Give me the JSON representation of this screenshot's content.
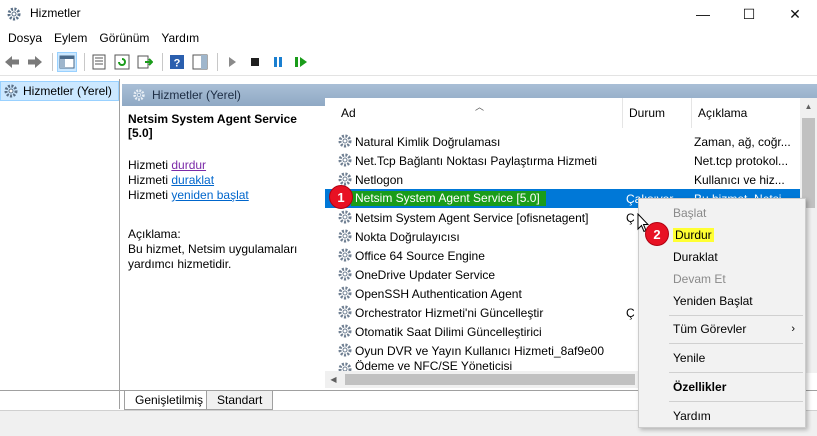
{
  "window": {
    "title": "Hizmetler",
    "min_glyph": "—",
    "max_glyph": "☐",
    "close_glyph": "✕"
  },
  "menu": [
    "Dosya",
    "Eylem",
    "Görünüm",
    "Yardım"
  ],
  "toolbar": {
    "icons": [
      "back-icon",
      "forward-icon",
      "show-hide-console-tree-icon",
      "properties-icon",
      "refresh-icon",
      "export-list-icon",
      "help-icon",
      "show-action-pane-icon",
      "start-service-icon",
      "stop-service-icon",
      "pause-service-icon",
      "restart-service-icon"
    ]
  },
  "tree": {
    "item_label": "Hizmetler (Yerel)"
  },
  "pane": {
    "header": "Hizmetler (Yerel)",
    "selected_title": "Netsim System Agent Service [5.0]",
    "action_prefix": "Hizmeti",
    "action_stop": "durdur",
    "action_pause": "duraklat",
    "action_restart": "yeniden başlat",
    "desc_label": "Açıklama:",
    "desc_text_1": "Bu hizmet, Netsim uygulamaları",
    "desc_text_2": "yardımcı hizmetidir."
  },
  "list": {
    "columns": {
      "name": "Ad",
      "status": "Durum",
      "description": "Açıklama"
    },
    "rows": [
      {
        "name": "Natural Kimlik Doğrulaması",
        "status": "",
        "description": "Zaman, ağ, coğr..."
      },
      {
        "name": "Net.Tcp Bağlantı Noktası Paylaştırma Hizmeti",
        "status": "",
        "description": "Net.tcp protokol..."
      },
      {
        "name": "Netlogon",
        "status": "",
        "description": "Kullanıcı ve hiz..."
      },
      {
        "name": "Netsim System Agent Service [5.0]",
        "status": "Çalışıyor",
        "description": "Bu hizmet, Netsi..."
      },
      {
        "name": "Netsim System Agent Service [ofisnetagent]",
        "status": "Ç",
        "description": ""
      },
      {
        "name": "Nokta Doğrulayıcısı",
        "status": "",
        "description": ""
      },
      {
        "name": "Office 64 Source Engine",
        "status": "",
        "description": ""
      },
      {
        "name": "OneDrive Updater Service",
        "status": "",
        "description": ""
      },
      {
        "name": "OpenSSH Authentication Agent",
        "status": "",
        "description": ""
      },
      {
        "name": "Orchestrator Hizmeti'ni Güncelleştir",
        "status": "Ç",
        "description": ""
      },
      {
        "name": "Otomatik Saat Dilimi Güncelleştirici",
        "status": "",
        "description": ""
      },
      {
        "name": "Oyun DVR ve Yayın Kullanıcı Hizmeti_8af9e00",
        "status": "",
        "description": ""
      },
      {
        "name": "Ödeme ve NFC/SE Yöneticisi",
        "status": "",
        "description": ""
      }
    ]
  },
  "tabs": [
    "Genişletilmiş",
    "Standart"
  ],
  "context_menu": {
    "start": "Başlat",
    "stop": "Durdur",
    "pause": "Duraklat",
    "resume": "Devam Et",
    "restart": "Yeniden Başlat",
    "all_tasks": "Tüm Görevler",
    "refresh": "Yenile",
    "properties": "Özellikler",
    "help": "Yardım",
    "submenu_glyph": "›"
  },
  "badges": {
    "one": "1",
    "two": "2"
  },
  "colors": {
    "selection": "#0078d7",
    "highlight_green": "#1a9c1a",
    "highlight_yellow": "#ffff33",
    "badge_red": "#e81123"
  }
}
